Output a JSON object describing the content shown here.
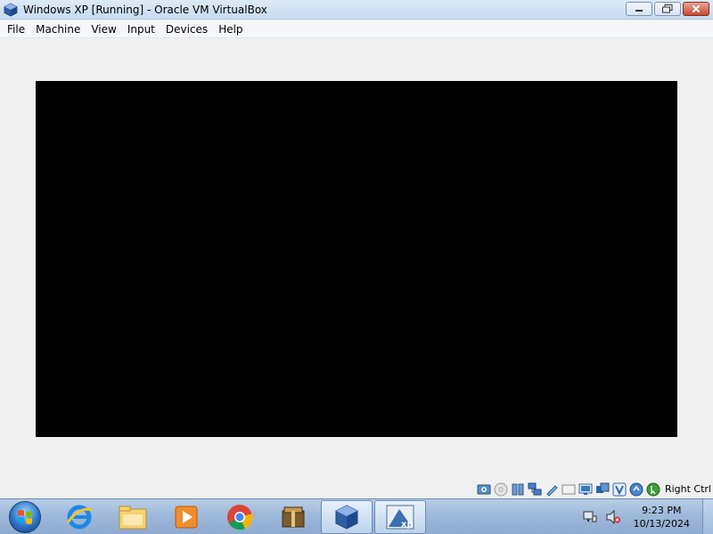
{
  "window": {
    "title": "Windows XP [Running] - Oracle VM VirtualBox",
    "app_icon": "virtualbox-icon",
    "caption_buttons": [
      "minimize",
      "maximize",
      "close"
    ]
  },
  "menu": {
    "items": [
      "File",
      "Machine",
      "View",
      "Input",
      "Devices",
      "Help"
    ]
  },
  "vm": {
    "screen_color": "#000000"
  },
  "statusbar": {
    "icons": [
      "hard-disk-icon",
      "optical-drive-icon",
      "audio-icon",
      "network-icon",
      "usb-icon",
      "shared-folders-icon",
      "display-icon",
      "video-capture-icon",
      "virtualization-icon",
      "cpu-icon",
      "mouse-integration-icon"
    ],
    "host_key": "Right Ctrl"
  },
  "taskbar": {
    "start": "windows-orb-icon",
    "pinned": [
      "internet-explorer-icon",
      "file-explorer-icon",
      "media-player-icon",
      "chrome-icon",
      "archive-icon",
      "virtualbox-icon",
      "windows-xp-vm-icon"
    ],
    "active": "windows-xp-vm-icon"
  },
  "tray": {
    "icons": [
      "network-tray-icon",
      "volume-muted-icon"
    ],
    "time": "9:23 PM",
    "date": "10/13/2024"
  }
}
